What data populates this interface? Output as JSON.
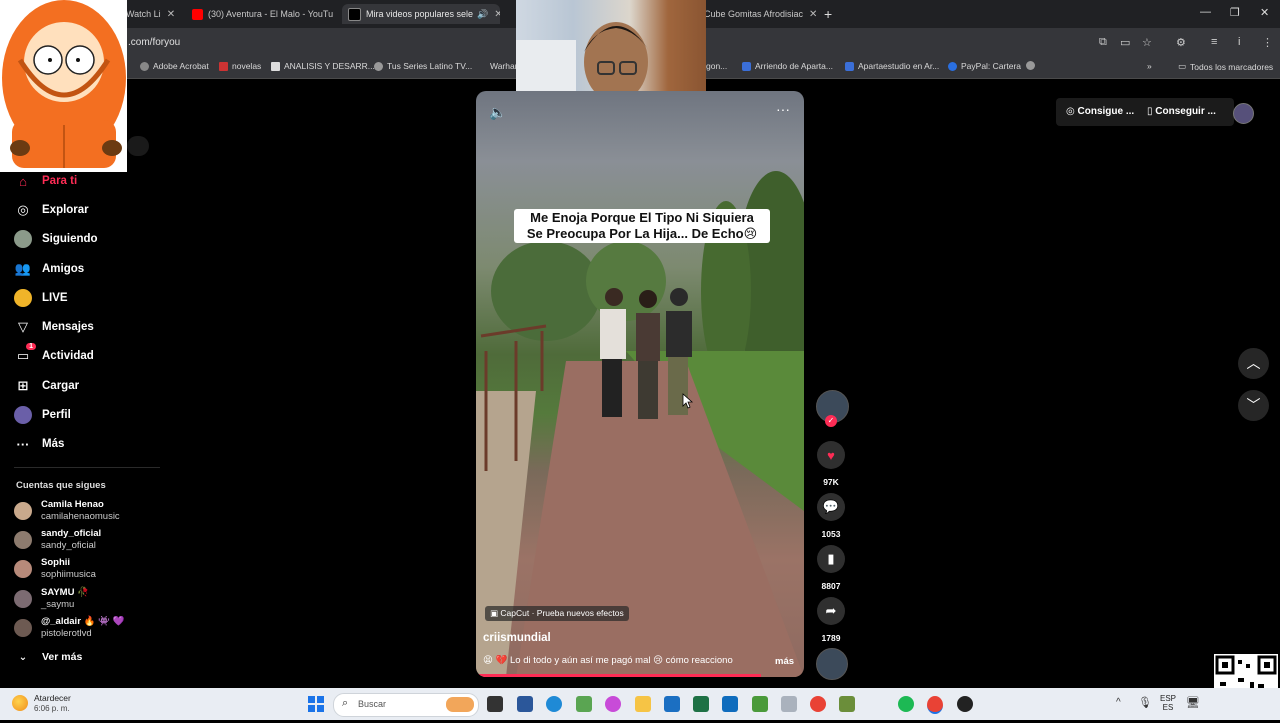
{
  "browser": {
    "tabs": [
      {
        "title": "Watch Li"
      },
      {
        "title": "(30) Aventura - El Malo - YouTu"
      },
      {
        "title": "Mira videos populares sele"
      },
      {
        "title": "Cube Gomitas Afrodisiac"
      }
    ],
    "url": ".com/foryou",
    "bookmarks": [
      "Adobe Acrobat",
      "novelas",
      "ANALISIS Y DESARR...",
      "Tus Series Latino TV...",
      "Warhan",
      "gon...",
      "Arriendo de Aparta...",
      "Apartaestudio en Ar...",
      "PayPal: Cartera"
    ],
    "all_bookmarks": "Todos los marcadores"
  },
  "sidebar": {
    "nav": [
      {
        "label": "Para ti",
        "icon": "home-icon"
      },
      {
        "label": "Explorar",
        "icon": "compass-icon"
      },
      {
        "label": "Siguiendo",
        "icon": "following-avatar"
      },
      {
        "label": "Amigos",
        "icon": "friends-icon"
      },
      {
        "label": "LIVE",
        "icon": "live-icon"
      },
      {
        "label": "Mensajes",
        "icon": "send-icon"
      },
      {
        "label": "Actividad",
        "icon": "activity-icon",
        "badge": "1"
      },
      {
        "label": "Cargar",
        "icon": "plus-icon"
      },
      {
        "label": "Perfil",
        "icon": "profile-avatar"
      },
      {
        "label": "Más",
        "icon": "more-icon"
      }
    ],
    "following_title": "Cuentas que sigues",
    "accounts": [
      {
        "name": "Camila Henao",
        "handle": "camilahenaomusic"
      },
      {
        "name": "sandy_oficial",
        "handle": "sandy_oficial"
      },
      {
        "name": "Sophii",
        "handle": "sophiimusica"
      },
      {
        "name": "SAYMU 🥀",
        "handle": "_saymu"
      },
      {
        "name": "@_aldair 🔥 👾 💜",
        "handle": "pistolerotlvd"
      }
    ],
    "see_more": "Ver más"
  },
  "topbar": {
    "coins": "Consigue ...",
    "app": "Conseguir ..."
  },
  "video": {
    "caption_line1": "Me Enoja Porque El Tipo Ni Siquiera",
    "caption_line2": "Se Preocupa Por La Hija... De Echo😢",
    "capcut": "CapCut · Prueba nuevos efectos",
    "author": "criismundial",
    "description": "😫 💔 Lo di todo y aún así me pagó mal 😢 cómo reacciono",
    "more": "más"
  },
  "actions": {
    "likes": "97K",
    "comments": "1053",
    "saves": "8807",
    "shares": "1789"
  },
  "taskbar": {
    "weather": "Atardecer",
    "time": "6:06 p. m.",
    "search_placeholder": "Buscar",
    "lang": "ESP",
    "region": "ES"
  },
  "colors": {
    "accent": "#fe2c55",
    "taskbar": "#e9edf3",
    "chrome_dark": "#202124"
  }
}
